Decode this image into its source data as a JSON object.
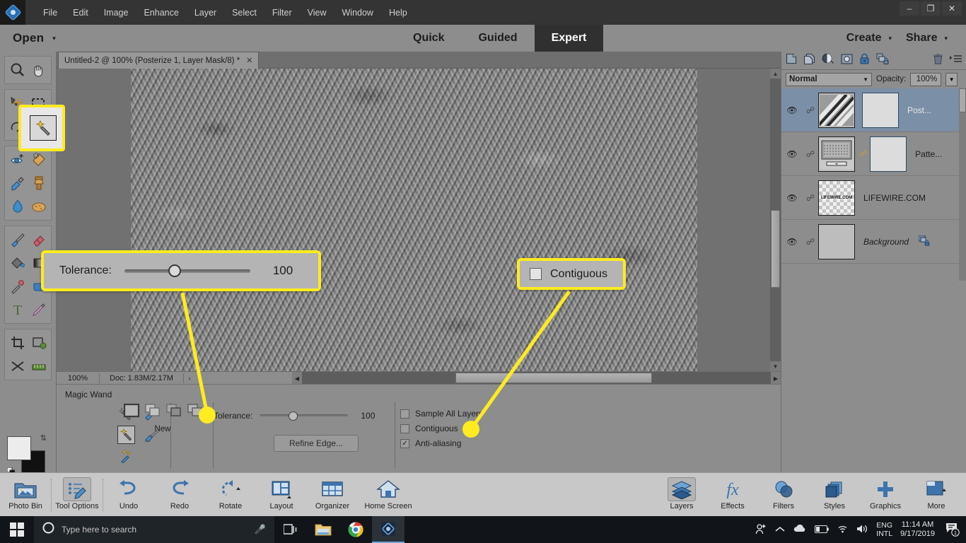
{
  "app": {
    "title": "Adobe Photoshop Elements",
    "logo_icon": "photoshop-elements-logo-icon"
  },
  "menubar": {
    "items": [
      "File",
      "Edit",
      "Image",
      "Enhance",
      "Layer",
      "Select",
      "Filter",
      "View",
      "Window",
      "Help"
    ],
    "window_controls": [
      {
        "name": "minimize",
        "glyph": "–"
      },
      {
        "name": "restore",
        "glyph": "❐"
      },
      {
        "name": "close",
        "glyph": "✕"
      }
    ]
  },
  "modebar": {
    "open_label": "Open",
    "open_caret": "▾",
    "modes": [
      {
        "label": "Quick",
        "active": false
      },
      {
        "label": "Guided",
        "active": false
      },
      {
        "label": "Expert",
        "active": true
      }
    ],
    "create_label": "Create",
    "share_label": "Share",
    "caret": "▾"
  },
  "tabbar": {
    "tab_title": "Untitled-2 @ 100% (Posterize 1, Layer Mask/8) *",
    "close_glyph": "✕"
  },
  "toolbar": {
    "tools": [
      {
        "name": "zoom-tool",
        "glyph": "⌕"
      },
      {
        "name": "hand-tool",
        "glyph": "✋"
      },
      {
        "name": "move-tool",
        "glyph": "✛"
      },
      {
        "name": "rectangular-marquee-tool",
        "glyph": "⬚"
      },
      {
        "name": "lasso-tool",
        "glyph": "⤵"
      },
      {
        "name": "magic-wand-tool",
        "glyph": "✨"
      },
      {
        "name": "red-eye-tool",
        "glyph": "◉"
      },
      {
        "name": "spot-healing-brush-tool",
        "glyph": "✒"
      },
      {
        "name": "smart-brush-tool",
        "glyph": "🖌"
      },
      {
        "name": "clone-stamp-tool",
        "glyph": "⬛"
      },
      {
        "name": "blur-tool",
        "glyph": "💧"
      },
      {
        "name": "sponge-tool",
        "glyph": "◓"
      },
      {
        "name": "brush-tool",
        "glyph": "🖌"
      },
      {
        "name": "eraser-tool",
        "glyph": "▭"
      },
      {
        "name": "paint-bucket-tool",
        "glyph": "🪣"
      },
      {
        "name": "gradient-tool",
        "glyph": "▣"
      },
      {
        "name": "color-picker-tool",
        "glyph": "💉"
      },
      {
        "name": "custom-shape-tool",
        "glyph": "■"
      },
      {
        "name": "type-tool",
        "glyph": "T"
      },
      {
        "name": "pencil-tool",
        "glyph": "✏"
      },
      {
        "name": "crop-tool",
        "glyph": "✂"
      },
      {
        "name": "recompose-tool",
        "glyph": "⚙"
      },
      {
        "name": "content-aware-move-tool",
        "glyph": "✖"
      },
      {
        "name": "straighten-tool",
        "glyph": "☲"
      }
    ],
    "selected_tool": "magic-wand-tool",
    "foreground_color": "#ececec",
    "background_color": "#111111"
  },
  "statusbar": {
    "zoom": "100%",
    "doc_info": "Doc: 1.83M/2.17M",
    "expand_glyph": "›"
  },
  "tool_options": {
    "title": "Magic Wand",
    "related_tools": [
      {
        "name": "quick-selection-tool"
      },
      {
        "name": "selection-brush-tool"
      },
      {
        "name": "magic-wand-tool"
      },
      {
        "name": "refine-selection-brush-tool"
      },
      {
        "name": "auto-selection-tool"
      }
    ],
    "selection_modes": [
      {
        "name": "new-selection",
        "active": true
      },
      {
        "name": "add-to-selection",
        "active": false
      },
      {
        "name": "subtract-from-selection",
        "active": false
      },
      {
        "name": "intersect-with-selection",
        "active": false
      }
    ],
    "selection_mode_label": "New",
    "tolerance_label": "Tolerance:",
    "tolerance_value": "100",
    "refine_edge_label": "Refine Edge...",
    "checkboxes": [
      {
        "label": "Sample All Layers",
        "checked": false
      },
      {
        "label": "Contiguous",
        "checked": false
      },
      {
        "label": "Anti-aliasing",
        "checked": true
      }
    ],
    "panel_icons": [
      {
        "name": "help-icon",
        "glyph": "?"
      },
      {
        "name": "panel-menu-icon",
        "glyph": "☰"
      },
      {
        "name": "collapse-panel-icon",
        "glyph": "⌄"
      }
    ]
  },
  "layers_panel": {
    "toolbar_icons": [
      {
        "name": "add-layer-icon"
      },
      {
        "name": "duplicate-layer-icon"
      },
      {
        "name": "adjustment-layer-icon"
      },
      {
        "name": "layer-mask-icon"
      },
      {
        "name": "lock-layer-icon"
      },
      {
        "name": "link-layers-icon"
      },
      {
        "name": "delete-layer-icon"
      },
      {
        "name": "layers-panel-menu-icon"
      }
    ],
    "blend_mode": "Normal",
    "opacity_label": "Opacity:",
    "opacity_value": "100%",
    "layers": [
      {
        "name": "Post...",
        "selected": true,
        "has_mask": true,
        "visible": true,
        "kind": "adjustment"
      },
      {
        "name": "Patte...",
        "selected": false,
        "has_mask": true,
        "visible": true,
        "kind": "pattern"
      },
      {
        "name": "LIFEWIRE.COM",
        "selected": false,
        "has_mask": false,
        "visible": true,
        "kind": "text",
        "thumb_text": "LIFEWIRE.COM"
      },
      {
        "name": "Background",
        "selected": false,
        "has_mask": false,
        "visible": true,
        "kind": "background",
        "italic": true
      }
    ]
  },
  "pse_taskbar": {
    "left_items": [
      {
        "label": "Photo Bin",
        "icon": "photo-bin-icon",
        "active": false
      },
      {
        "label": "Tool Options",
        "icon": "tool-options-icon",
        "active": true
      },
      {
        "label": "Undo",
        "icon": "undo-icon",
        "active": false
      },
      {
        "label": "Redo",
        "icon": "redo-icon",
        "active": false
      },
      {
        "label": "Rotate",
        "icon": "rotate-icon",
        "active": false
      },
      {
        "label": "Layout",
        "icon": "layout-icon",
        "active": false
      },
      {
        "label": "Organizer",
        "icon": "organizer-icon",
        "active": false
      },
      {
        "label": "Home Screen",
        "icon": "home-screen-icon",
        "active": false
      }
    ],
    "right_items": [
      {
        "label": "Layers",
        "icon": "layers-icon",
        "active": true
      },
      {
        "label": "Effects",
        "icon": "effects-icon",
        "active": false
      },
      {
        "label": "Filters",
        "icon": "filters-icon",
        "active": false
      },
      {
        "label": "Styles",
        "icon": "styles-icon",
        "active": false
      },
      {
        "label": "Graphics",
        "icon": "graphics-icon",
        "active": false
      },
      {
        "label": "More",
        "icon": "more-icon",
        "active": false
      }
    ]
  },
  "windows_taskbar": {
    "start_icon": "windows-start-icon",
    "search_placeholder": "Type here to search",
    "search_icon": "search-circle-icon",
    "mic_icon": "microphone-icon",
    "pinned": [
      {
        "name": "task-view-icon"
      },
      {
        "name": "file-explorer-icon"
      },
      {
        "name": "google-chrome-icon"
      },
      {
        "name": "photoshop-elements-taskbar-icon",
        "running": true
      }
    ],
    "tray": [
      {
        "name": "people-icon",
        "glyph": "⚹"
      },
      {
        "name": "show-hidden-icons-icon",
        "glyph": "⌃"
      },
      {
        "name": "onedrive-icon",
        "glyph": "☁"
      },
      {
        "name": "battery-icon",
        "glyph": "▭"
      },
      {
        "name": "wifi-icon",
        "glyph": "◡"
      },
      {
        "name": "volume-icon",
        "glyph": "🔊"
      }
    ],
    "language_line1": "ENG",
    "language_line2": "INTL",
    "time": "11:14 AM",
    "date": "9/17/2019",
    "notification_icon": "action-center-icon",
    "notification_count": "1"
  },
  "callouts": {
    "accent_color": "#ffeb1f",
    "tolerance": {
      "label": "Tolerance:",
      "value": "100"
    },
    "contiguous": {
      "label": "Contiguous",
      "checked": false
    },
    "highlighted_tool": "magic-wand-tool"
  }
}
